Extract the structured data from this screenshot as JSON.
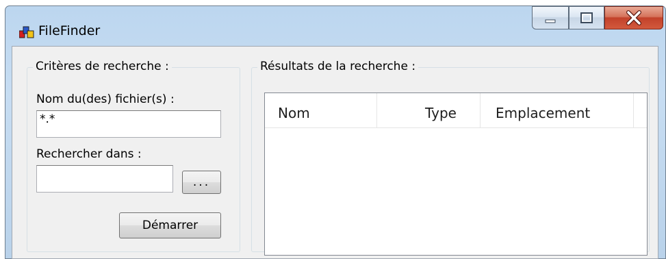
{
  "window": {
    "title": "FileFinder",
    "controls": {
      "minimize": "minimize",
      "maximize": "maximize",
      "close": "close"
    }
  },
  "criteria": {
    "legend": "Critères de recherche :",
    "filename_label": "Nom du(des) fichier(s) :",
    "filename_value": "*.*",
    "folder_label": "Rechercher dans :",
    "folder_value": "",
    "browse_label": "...",
    "start_label": "Démarrer"
  },
  "results": {
    "legend": "Résultats de la recherche :",
    "columns": [
      "Nom",
      "Type",
      "Emplacement"
    ],
    "rows": []
  },
  "colors": {
    "frame": "#c7ddf2",
    "client": "#f0f0f0",
    "close_button": "#c2412a"
  }
}
